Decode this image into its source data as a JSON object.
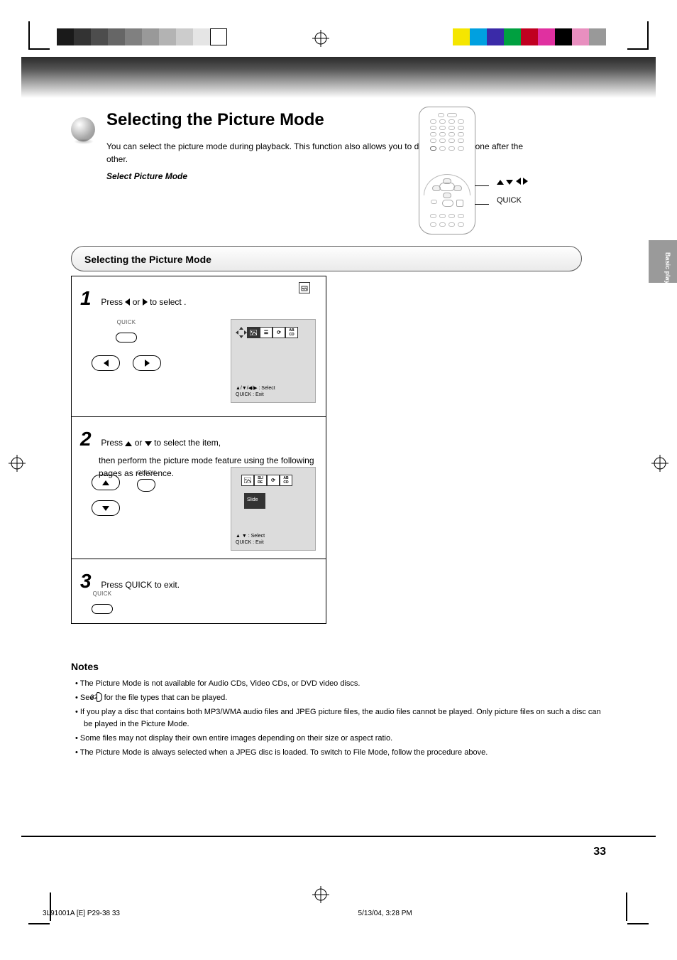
{
  "title": {
    "heading": "Selecting the Picture Mode",
    "sub": "You can select the picture mode during playback. This function also allows you to display pictures one after the other.",
    "subtitle": "Select Picture Mode"
  },
  "remote": {
    "label_arrows": "▲ ▼ ◀ ▶",
    "label_quick": "QUICK"
  },
  "pill": "Selecting the Picture Mode",
  "steps": [
    {
      "num": "1",
      "line1_a": "Press ",
      "line1_b": " or ",
      "line1_c": " to select ",
      "line1_d": ".",
      "btn_label": "QUICK",
      "screen_caption1": "▲/▼/◀/▶ : Select",
      "screen_caption2": "QUICK : Exit"
    },
    {
      "num": "2",
      "line1_a": "Press ",
      "line1_b": " or ",
      "line1_c": " to select the item,",
      "line2": "then perform the picture mode feature using the following pages as reference.",
      "btn_label": "QUICK",
      "sel_label": "Slide",
      "screen_caption1": "▲ ▼ : Select",
      "screen_caption2": "QUICK : Exit"
    },
    {
      "num": "3",
      "line1": "Press QUICK to exit.",
      "btn_label": "QUICK"
    }
  ],
  "notes": {
    "heading": "Notes",
    "items": [
      "The Picture Mode is not available for Audio CDs, Video CDs, or DVD video discs.",
      {
        "pre": "See ",
        "page": "32",
        "post": " for the file types that can be played."
      },
      "If you play a disc that contains both MP3/WMA audio files and JPEG picture files, the audio files cannot be played. Only picture files on such a disc can be played in the Picture Mode.",
      "Some files may not display their own entire images depending on their size or aspect ratio.",
      "The Picture Mode is always selected when a JPEG disc is loaded. To switch to File Mode, follow the procedure above."
    ]
  },
  "page_number": "33",
  "footer": "3L91001A [E] P29-38    33",
  "footer_time": "5/13/04, 3:28 PM",
  "colors": {
    "grays": [
      "#1a1a1a",
      "#333",
      "#4d4d4d",
      "#666",
      "#808080",
      "#999",
      "#b3b3b3",
      "#ccc",
      "#e5e5e5",
      "#fff"
    ],
    "colors": [
      "#f5e600",
      "#00a0e0",
      "#3a2aa8",
      "#00a040",
      "#c00020",
      "#e030a0",
      "#000",
      "#e88fbf",
      "#999"
    ]
  }
}
